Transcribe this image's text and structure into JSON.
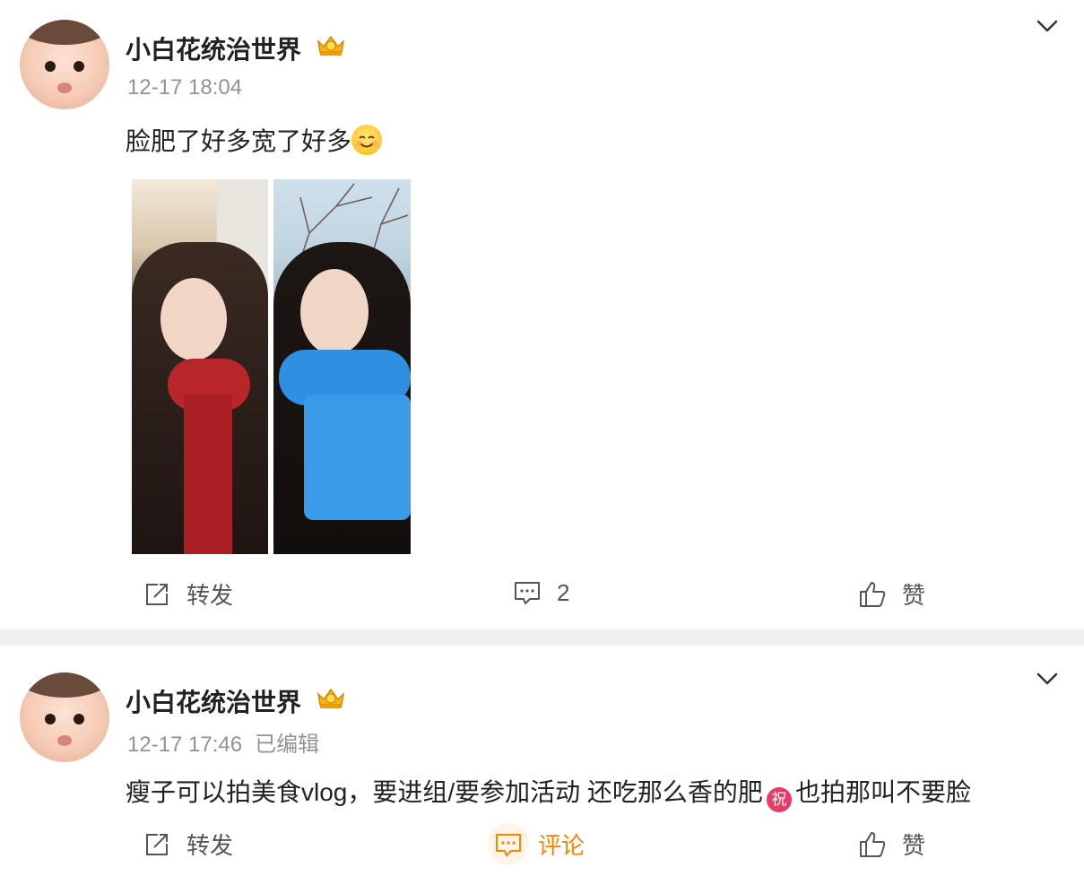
{
  "posts": [
    {
      "username": "小白花统治世界",
      "timestamp": "12-17 18:04",
      "edited": "",
      "text": "脸肥了好多宽了好多",
      "emoji": "smile-emoji",
      "actions": {
        "repost": "转发",
        "comment": "2",
        "like": "赞"
      }
    },
    {
      "username": "小白花统治世界",
      "timestamp": "12-17 17:46",
      "edited": "已编辑",
      "text_before": "瘦子可以拍美食vlog，要进组/要参加活动 还吃那么香的肥",
      "badge": "祝",
      "text_after": "也拍那叫不要脸",
      "actions": {
        "repost": "转发",
        "comment": "评论",
        "like": "赞"
      }
    }
  ],
  "colors": {
    "accent": "#ff8200",
    "meta": "#939393",
    "separator": "#eef0f3",
    "badge": "#e73c63"
  },
  "icons": [
    "chevron-down-icon",
    "crown-icon",
    "repost-icon",
    "comment-icon",
    "like-icon"
  ]
}
